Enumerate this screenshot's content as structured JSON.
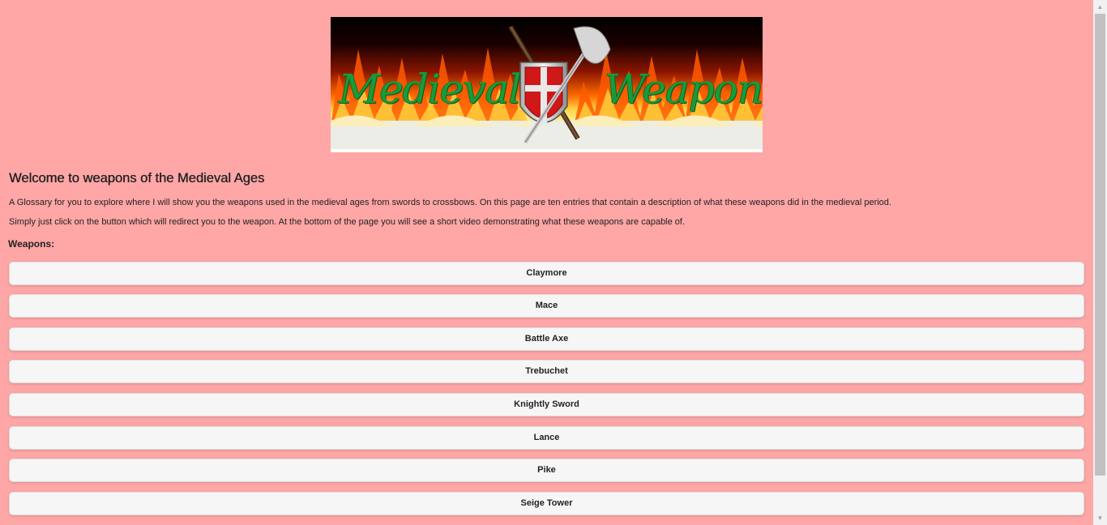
{
  "banner": {
    "alt": "Medieval Weapons banner",
    "left_text": "Medieval",
    "right_text": "Weapons"
  },
  "welcome": {
    "heading": "Welcome to weapons of the Medieval Ages",
    "paragraph1": "A Glossary for you to explore where I will show you the weapons used in the medieval ages from swords to crossbows. On this page are ten entries that contain a description of what these weapons did in the medieval period.",
    "paragraph2": "Simply just click on the button which will redirect you to the weapon. At the bottom of the page you will see a short video demonstrating what these weapons are capable of."
  },
  "weapons": {
    "label": "Weapons:",
    "buttons": [
      {
        "label": "Claymore"
      },
      {
        "label": "Mace"
      },
      {
        "label": "Battle Axe"
      },
      {
        "label": "Trebuchet"
      },
      {
        "label": "Knightly Sword"
      },
      {
        "label": "Lance"
      },
      {
        "label": "Pike"
      },
      {
        "label": "Seige Tower"
      }
    ]
  },
  "colors": {
    "background": "#ffa6a6",
    "button_bg": "#f6f6f6",
    "banner_text": "#1a9a3a"
  },
  "scrollbar": {
    "up_icon": "triangle-up-icon",
    "down_icon": "triangle-down-icon"
  }
}
